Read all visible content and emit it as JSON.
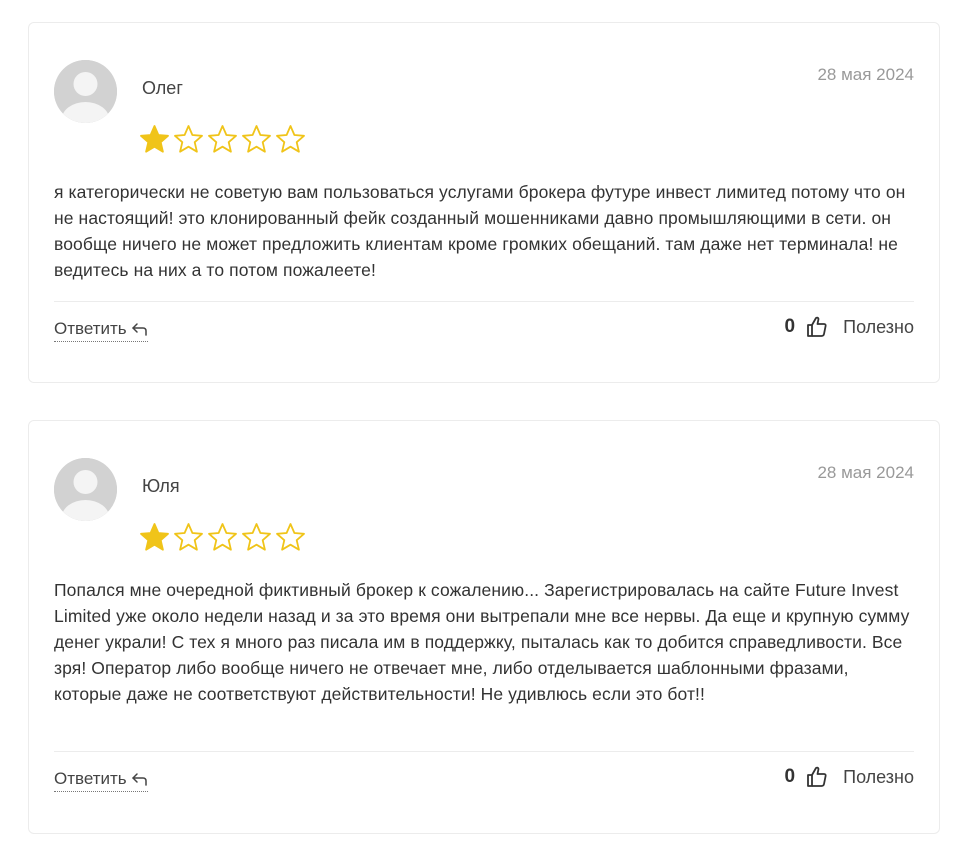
{
  "reviews": [
    {
      "author": "Олег",
      "date": "28 мая 2024",
      "rating": 1,
      "rating_max": 5,
      "text": "я категорически не советую вам пользоваться услугами брокера футуре инвест лимитед потому что он не настоящий! это клонированный фейк созданный мошенниками давно промышляющими в сети. он вообще ничего не может предложить клиентам кроме громких обещаний. там даже нет терминала! не ведитесь на них а то потом пожалеете!",
      "reply_label": "Ответить",
      "helpful_count": "0",
      "helpful_label": "Полезно"
    },
    {
      "author": "Юля",
      "date": "28 мая 2024",
      "rating": 1,
      "rating_max": 5,
      "text": "Попался мне очередной фиктивный брокер к сожалению... Зарегистрировалась на сайте Future Invest Limited уже около недели назад и за это время они вытрепали мне все нервы. Да еще и крупную сумму денег украли! С тех я много раз писала им в поддержку, пыталась как то добится справедливости. Все зря! Оператор либо вообще ничего не отвечает мне, либо отделывается шаблонными фразами, которые даже не соответствуют действительности! Не удивлюсь если это бот!!",
      "reply_label": "Ответить",
      "helpful_count": "0",
      "helpful_label": "Полезно"
    }
  ],
  "icons": {
    "avatar": "user-avatar-placeholder",
    "star_filled": "star-filled-icon",
    "star_empty": "star-outline-icon",
    "reply": "reply-arrow-icon",
    "helpful": "thumbs-up-icon"
  },
  "colors": {
    "star": "#f0c419",
    "card_border": "#ececec",
    "date": "#999999",
    "avatar_bg": "#d2d2d2"
  }
}
